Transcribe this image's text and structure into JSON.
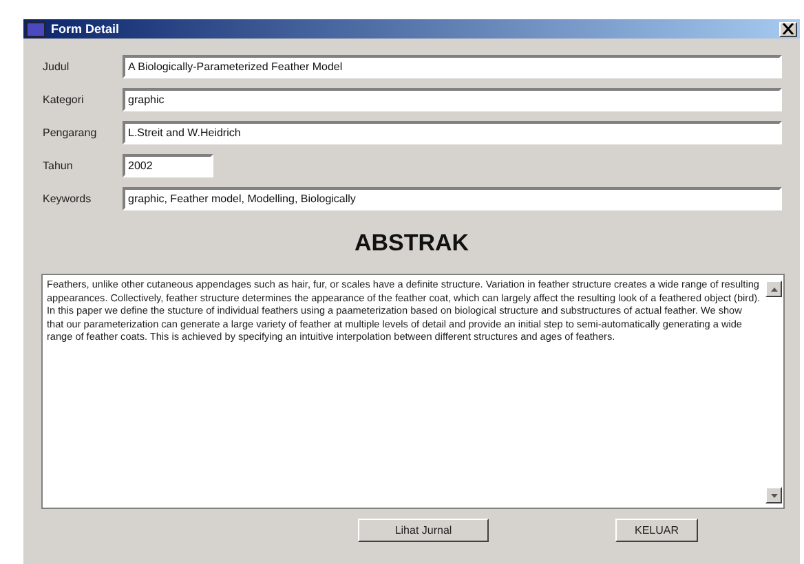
{
  "window": {
    "title": "Form Detail"
  },
  "fields": [
    {
      "label": "Judul",
      "value": "A Biologically-Parameterized Feather Model",
      "kind": "wide"
    },
    {
      "label": "Kategori",
      "value": "graphic",
      "kind": "wide"
    },
    {
      "label": "Pengarang",
      "value": "L.Streit and W.Heidrich",
      "kind": "wide"
    },
    {
      "label": "Tahun",
      "value": "2002",
      "kind": "short"
    },
    {
      "label": "Keywords",
      "value": "graphic, Feather model, Modelling, Biologically",
      "kind": "wide"
    }
  ],
  "abstract": {
    "heading": "ABSTRAK",
    "text": "Feathers, unlike other cutaneous appendages such as hair, fur, or scales have a definite structure. Variation in feather structure creates a wide range of resulting appearances. Collectively, feather structure determines the appearance of the feather coat, which can largely affect the resulting look of a feathered object (bird). In this paper we define the stucture of individual feathers using a paameterization based on biological structure and substructures of actual feather. We show that our parameterization can generate a large variety of feather at multiple levels of detail and provide an initial step to semi-automatically generating a wide range of feather coats. This is achieved by specifying an intuitive interpolation between different structures and ages of feathers."
  },
  "buttons": [
    "Lihat Jurnal",
    "KELUAR"
  ]
}
